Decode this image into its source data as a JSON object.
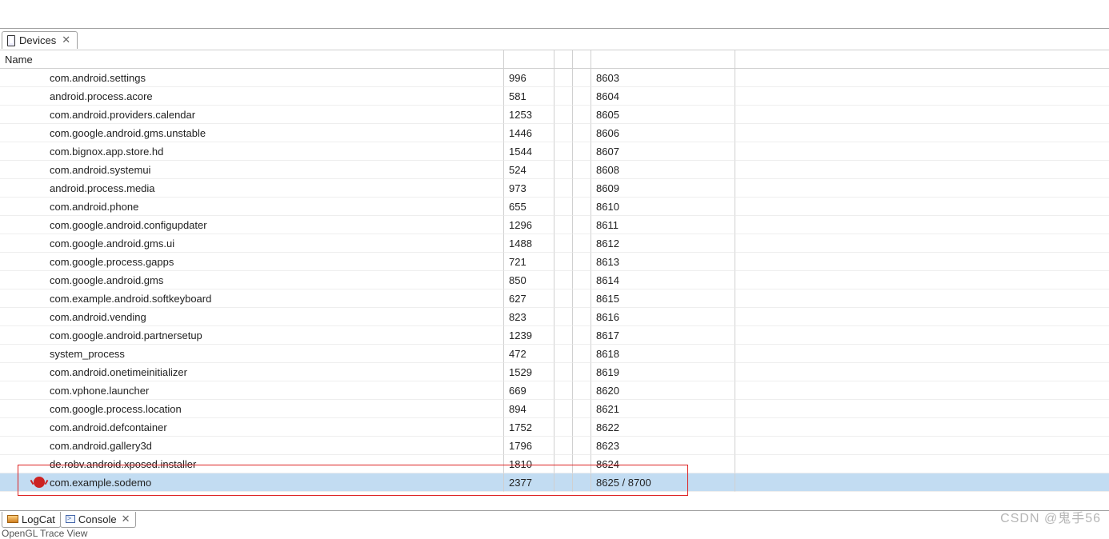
{
  "tabs": {
    "devices": {
      "label": "Devices"
    }
  },
  "header": {
    "name": "Name"
  },
  "rows": [
    {
      "name": "com.android.settings",
      "pid": "996",
      "port": "8603",
      "selected": false
    },
    {
      "name": "android.process.acore",
      "pid": "581",
      "port": "8604",
      "selected": false
    },
    {
      "name": "com.android.providers.calendar",
      "pid": "1253",
      "port": "8605",
      "selected": false
    },
    {
      "name": "com.google.android.gms.unstable",
      "pid": "1446",
      "port": "8606",
      "selected": false
    },
    {
      "name": "com.bignox.app.store.hd",
      "pid": "1544",
      "port": "8607",
      "selected": false
    },
    {
      "name": "com.android.systemui",
      "pid": "524",
      "port": "8608",
      "selected": false
    },
    {
      "name": "android.process.media",
      "pid": "973",
      "port": "8609",
      "selected": false
    },
    {
      "name": "com.android.phone",
      "pid": "655",
      "port": "8610",
      "selected": false
    },
    {
      "name": "com.google.android.configupdater",
      "pid": "1296",
      "port": "8611",
      "selected": false
    },
    {
      "name": "com.google.android.gms.ui",
      "pid": "1488",
      "port": "8612",
      "selected": false
    },
    {
      "name": "com.google.process.gapps",
      "pid": "721",
      "port": "8613",
      "selected": false
    },
    {
      "name": "com.google.android.gms",
      "pid": "850",
      "port": "8614",
      "selected": false
    },
    {
      "name": "com.example.android.softkeyboard",
      "pid": "627",
      "port": "8615",
      "selected": false
    },
    {
      "name": "com.android.vending",
      "pid": "823",
      "port": "8616",
      "selected": false
    },
    {
      "name": "com.google.android.partnersetup",
      "pid": "1239",
      "port": "8617",
      "selected": false
    },
    {
      "name": "system_process",
      "pid": "472",
      "port": "8618",
      "selected": false
    },
    {
      "name": "com.android.onetimeinitializer",
      "pid": "1529",
      "port": "8619",
      "selected": false
    },
    {
      "name": "com.vphone.launcher",
      "pid": "669",
      "port": "8620",
      "selected": false
    },
    {
      "name": "com.google.process.location",
      "pid": "894",
      "port": "8621",
      "selected": false
    },
    {
      "name": "com.android.defcontainer",
      "pid": "1752",
      "port": "8622",
      "selected": false
    },
    {
      "name": "com.android.gallery3d",
      "pid": "1796",
      "port": "8623",
      "selected": false
    },
    {
      "name": "de.robv.android.xposed.installer",
      "pid": "1810",
      "port": "8624",
      "selected": false
    },
    {
      "name": "com.example.sodemo",
      "pid": "2377",
      "port": "8625 / 8700",
      "selected": true,
      "debug": true
    }
  ],
  "bottomTabs": {
    "logcat": {
      "label": "LogCat"
    },
    "console": {
      "label": "Console"
    }
  },
  "watermark": "CSDN @鬼手56",
  "footerHint": "OpenGL Trace View"
}
